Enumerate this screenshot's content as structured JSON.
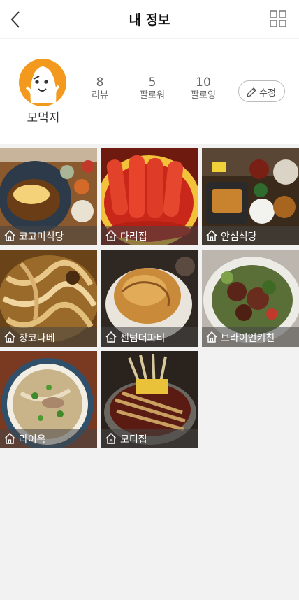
{
  "header": {
    "title": "내 정보",
    "back_icon": "chevron-left-icon",
    "grid_icon": "grid-view-icon"
  },
  "profile": {
    "nickname": "모먹지",
    "avatar_icon": "ghost-mascot-avatar",
    "stats": [
      {
        "count": "8",
        "label": "리뷰"
      },
      {
        "count": "5",
        "label": "팔로워"
      },
      {
        "count": "10",
        "label": "팔로잉"
      }
    ],
    "edit_label": "수정"
  },
  "restaurants": [
    {
      "name": "코고미식당",
      "food": "omurice curry plate"
    },
    {
      "name": "다리집",
      "food": "tteokbokki"
    },
    {
      "name": "안심식당",
      "food": "tonkatsu set"
    },
    {
      "name": "창코나베",
      "food": "hot pot noodles"
    },
    {
      "name": "센텀더파티",
      "food": "pot pie"
    },
    {
      "name": "브라이언키친",
      "food": "steak salad"
    },
    {
      "name": "라이옥",
      "food": "pho noodle soup"
    },
    {
      "name": "모티집",
      "food": "grilled meat skewers"
    }
  ],
  "colors": {
    "accent": "#f39a1e",
    "header_bg": "#ffffff",
    "page_bg": "#f2f2f2"
  }
}
